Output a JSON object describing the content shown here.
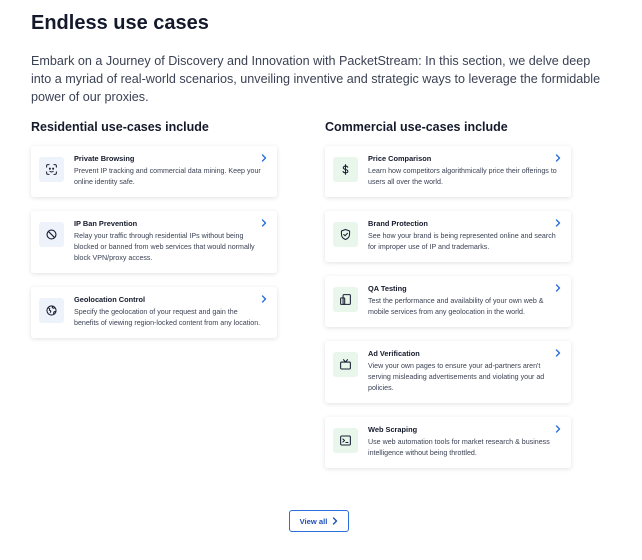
{
  "section": {
    "title": "Endless use cases",
    "intro": "Embark on a Journey of Discovery and Innovation with PacketStream: In this section, we delve deep into a myriad of real-world scenarios, unveiling inventive and strategic ways to leverage the formidable power of our proxies."
  },
  "residential": {
    "heading": "Residential use-cases include",
    "items": [
      {
        "title": "Private Browsing",
        "desc": "Prevent IP tracking and commercial data mining. Keep your online identity safe.",
        "icon": "face-scan-icon"
      },
      {
        "title": "IP Ban Prevention",
        "desc": "Relay your traffic through residential IPs without being blocked or banned from web services that would normally block VPN/proxy access.",
        "icon": "ban-icon"
      },
      {
        "title": "Geolocation Control",
        "desc": "Specify the geolocation of your request and gain the benefits of viewing region-locked content from any location.",
        "icon": "globe-icon"
      }
    ]
  },
  "commercial": {
    "heading": "Commercial use-cases include",
    "items": [
      {
        "title": "Price Comparison",
        "desc": "Learn how competitors algorithmically price their offerings to users all over the world.",
        "icon": "dollar-icon"
      },
      {
        "title": "Brand Protection",
        "desc": "See how your brand is being represented online and search for improper use of IP and trademarks.",
        "icon": "shield-check-icon"
      },
      {
        "title": "QA Testing",
        "desc": "Test the performance and availability of your own web & mobile services from any geolocation in the world.",
        "icon": "devices-icon"
      },
      {
        "title": "Ad Verification",
        "desc": "View your own pages to ensure your ad-partners aren't serving misleading advertisements and violating your ad policies.",
        "icon": "tv-icon"
      },
      {
        "title": "Web Scraping",
        "desc": "Use web automation tools for market research & business intelligence without being throttled.",
        "icon": "terminal-icon"
      }
    ]
  },
  "cta": {
    "view_all": "View all"
  },
  "colors": {
    "accent": "#2a6fdb",
    "blue_tint": "#edf2fb",
    "green_tint": "#e9f6ec",
    "heading": "#141a2b"
  }
}
